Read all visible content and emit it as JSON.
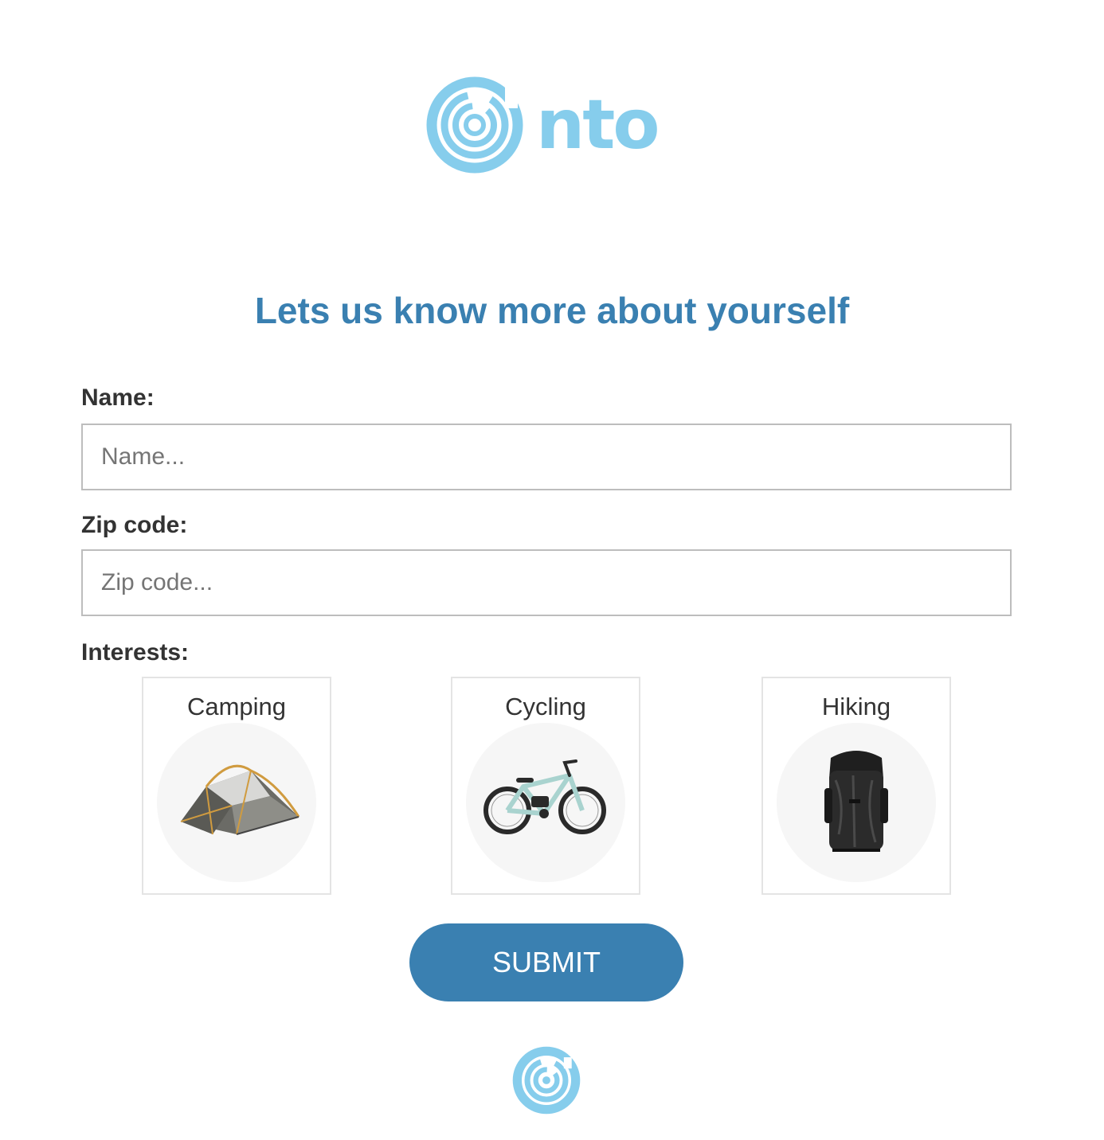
{
  "brand": {
    "name": "nto",
    "color": "#86cdec",
    "logo_icon": "nto-swirl-logo-icon"
  },
  "form": {
    "heading": "Lets us know more about yourself",
    "heading_color": "#3a80b1",
    "name_field": {
      "label": "Name:",
      "placeholder": "Name...",
      "value": ""
    },
    "zip_field": {
      "label": "Zip code:",
      "placeholder": "Zip code...",
      "value": ""
    },
    "interests": {
      "label": "Interests:",
      "options": [
        {
          "label": "Camping",
          "icon": "tent-icon"
        },
        {
          "label": "Cycling",
          "icon": "bicycle-icon"
        },
        {
          "label": "Hiking",
          "icon": "backpack-icon"
        }
      ]
    },
    "submit_label": "SUBMIT",
    "submit_color": "#3a80b1"
  },
  "footer": {
    "logo_icon": "nto-swirl-logo-icon"
  }
}
